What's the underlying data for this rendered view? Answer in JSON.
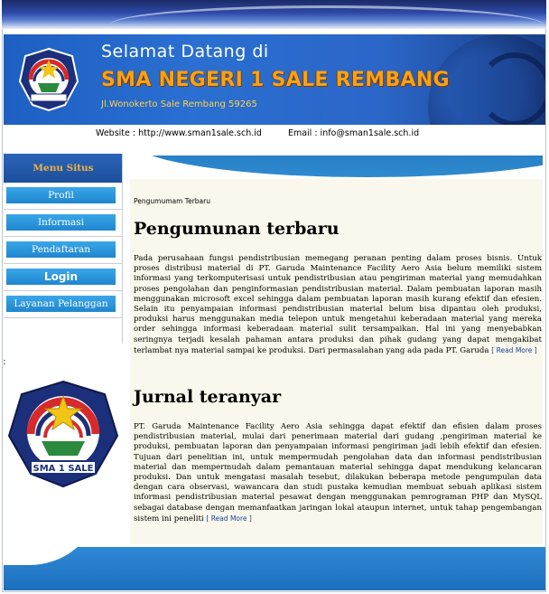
{
  "header": {
    "welcome": "Selamat Datang di",
    "school_name": "SMA NEGERI 1 SALE REMBANG",
    "address": "Jl.Wonokerto Sale Rembang 59265",
    "website": "Website :  http://www.sman1sale.sch.id",
    "email": "Email : info@sman1sale.sch.id",
    "logo_text": "SMA 1 SALE"
  },
  "sidebar": {
    "title": "Menu Situs",
    "items": [
      {
        "label": "Profil"
      },
      {
        "label": "Informasi"
      },
      {
        "label": "Pendaftaran"
      },
      {
        "label": "Login"
      },
      {
        "label": "Layanan Pelanggan"
      }
    ],
    "stray": ":",
    "logo_text": "SMA 1 SALE"
  },
  "content": {
    "breadcrumb": "Pengumumam Terbaru",
    "sections": [
      {
        "title": "Pengumunan terbaru",
        "body": "Pada perusahaan fungsi pendistribusian memegang peranan penting dalam proses bisnis. Untuk proses distribusi material di PT. Garuda Maintenance Facility Aero Asia belum memiliki sistem informasi yang terkomputerisasi untuk pendistribusian atau pengiriman material yang memudahkan proses pengolahan dan penginformasian pendistribusian material. Dalam pembuatan laporan masih menggunakan microsoft excel sehingga dalam pembuatan laporan masih kurang efektif dan efesien. Selain itu penyampaian informasi pendistribusian material belum bisa dipantau oleh produksi, produksi harus menggunakan media telepon untuk mengetahui keberadaan material yang mereka order sehingga informasi keberadaan material sulit tersampaikan. Hal ini yang menyebabkan seringnya terjadi kesalah pahaman antara produksi dan pihak gudang yang dapat mengakibat terlambat nya material sampai ke produksi. Dari permasalahan yang ada pada PT. Garuda",
        "read_more": "[ Read More ]"
      },
      {
        "title": "Jurnal teranyar",
        "body": "PT. Garuda Maintenance Facility Aero Asia sehingga dapat efektif dan efisien dalam proses pendistribusian material, mulai dari penerimaan material dari gudang ,pengiriman material ke produksi, pembuatan laporan dan penyampaian informasi pengiriman jadi lebih efektif dan efesien. Tujuan dari penelitian ini, untuk mempermudah pengolahan data dan informasi pendistribusian material dan mempermudah dalam pemantauan material sehingga dapat mendukung kelancaran produksi. Dan untuk mengatasi masalah tesebut, dilakukan beberapa metode pengumpulan data dengan cara observasi, wawancara dan studi pustaka kemudian membuat sebuah aplikasi sistem informasi pendistribusian material pesawat dengan menggunakan pemrograman PHP dan MySQL sebagai database dengan memanfaatkan jaringan lokal ataupun internet, untuk tahap pengembangan sistem ini peneliti",
        "read_more": "[ Read More ]"
      }
    ]
  },
  "colors": {
    "banner_blue": "#2a6fd1",
    "school_orange": "#f5a21b",
    "menu_button": "#2a94dc",
    "content_bg": "#faf8ec"
  }
}
